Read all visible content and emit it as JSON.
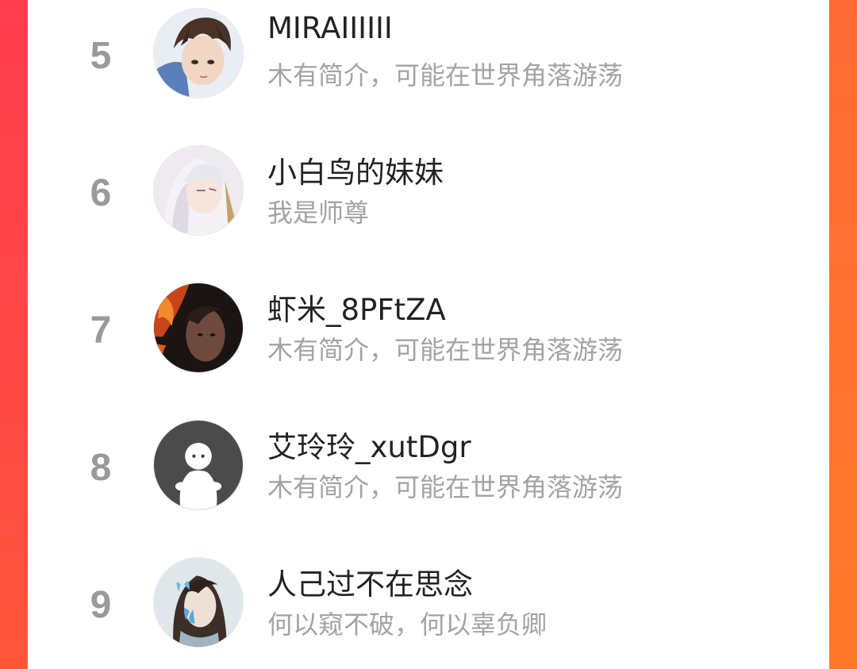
{
  "ranking_list": {
    "items": [
      {
        "rank": "5",
        "name": "MIRAIIIIII",
        "bio": "木有简介，可能在世界角落游荡",
        "avatar_icon": "anime-boy-brown-hair-avatar"
      },
      {
        "rank": "6",
        "name": "小白鸟的妹妹",
        "bio": "我是师尊",
        "avatar_icon": "anime-white-hair-avatar"
      },
      {
        "rank": "7",
        "name": "虾米_8PFtZA",
        "bio": "木有简介，可能在世界角落游荡",
        "avatar_icon": "fire-portrait-avatar"
      },
      {
        "rank": "8",
        "name": "艾玲玲_xutDgr",
        "bio": "木有简介，可能在世界角落游荡",
        "avatar_icon": "default-ghost-avatar"
      },
      {
        "rank": "9",
        "name": "人己过不在思念",
        "bio": "何以窥不破，何以辜负卿",
        "avatar_icon": "butterfly-portrait-avatar"
      }
    ]
  },
  "colors": {
    "accent_left": "#ff3d4f",
    "accent_right": "#ff7a2a",
    "rank_text": "#9a9a9a",
    "name_text": "#222222",
    "bio_text": "#a3a3a3"
  }
}
